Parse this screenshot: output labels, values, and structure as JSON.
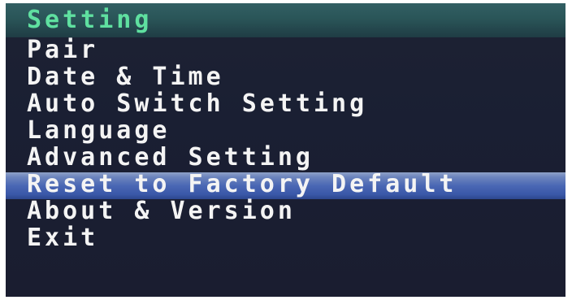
{
  "title": "Setting",
  "menu": {
    "items": [
      {
        "label": "Pair"
      },
      {
        "label": "Date & Time"
      },
      {
        "label": "Auto Switch Setting"
      },
      {
        "label": "Language"
      },
      {
        "label": "Advanced Setting"
      },
      {
        "label": "Reset to Factory Default"
      },
      {
        "label": "About & Version"
      },
      {
        "label": "Exit"
      }
    ],
    "selected_index": 5
  },
  "colors": {
    "title_text": "#5fe0a0",
    "item_text": "#f4f4f4",
    "background": "#1a1f33",
    "highlight": "#4a67b4"
  }
}
